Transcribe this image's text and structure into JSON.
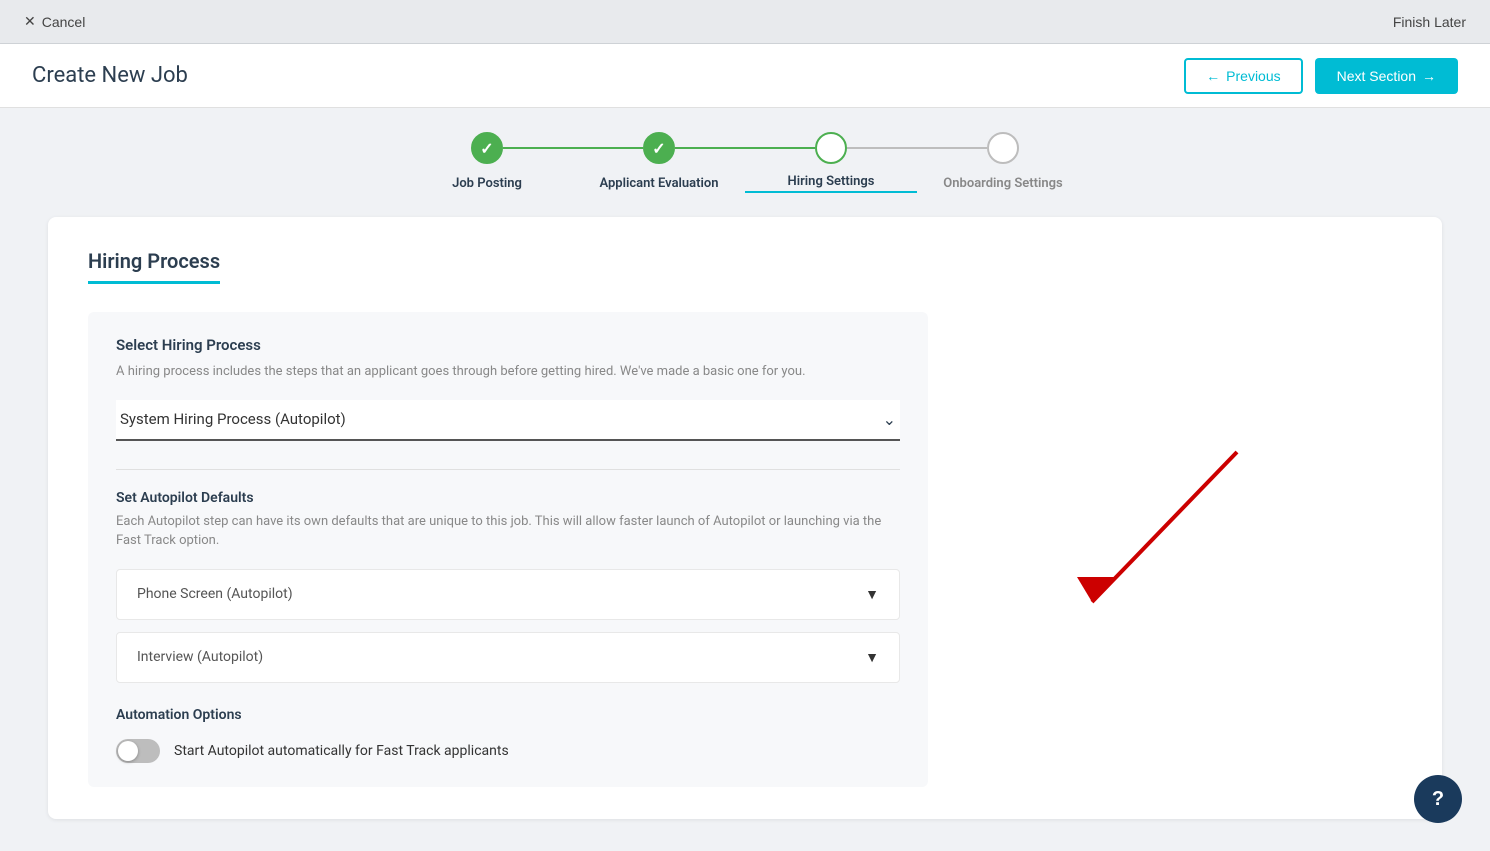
{
  "topbar": {
    "cancel_label": "Cancel",
    "finish_later_label": "Finish Later"
  },
  "header": {
    "title": "Create New Job",
    "previous_label": "Previous",
    "next_label": "Next Section"
  },
  "steps": [
    {
      "label": "Job Posting",
      "state": "completed"
    },
    {
      "label": "Applicant Evaluation",
      "state": "completed"
    },
    {
      "label": "Hiring Settings",
      "state": "active"
    },
    {
      "label": "Onboarding Settings",
      "state": "inactive"
    }
  ],
  "section": {
    "title": "Hiring Process",
    "inner_box": {
      "title": "Select Hiring Process",
      "description": "A hiring process includes the steps that an applicant goes through before getting hired. We've made a basic one for you.",
      "dropdown_value": "System Hiring Process (Autopilot)"
    },
    "autopilot": {
      "title": "Set Autopilot Defaults",
      "description": "Each Autopilot step can have its own defaults that are unique to this job. This will allow faster launch of Autopilot or launching via the Fast Track option.",
      "items": [
        {
          "label": "Phone Screen (Autopilot)"
        },
        {
          "label": "Interview (Autopilot)"
        }
      ]
    },
    "automation": {
      "title": "Automation Options",
      "toggle_label": "Start Autopilot automatically for Fast Track applicants"
    }
  }
}
